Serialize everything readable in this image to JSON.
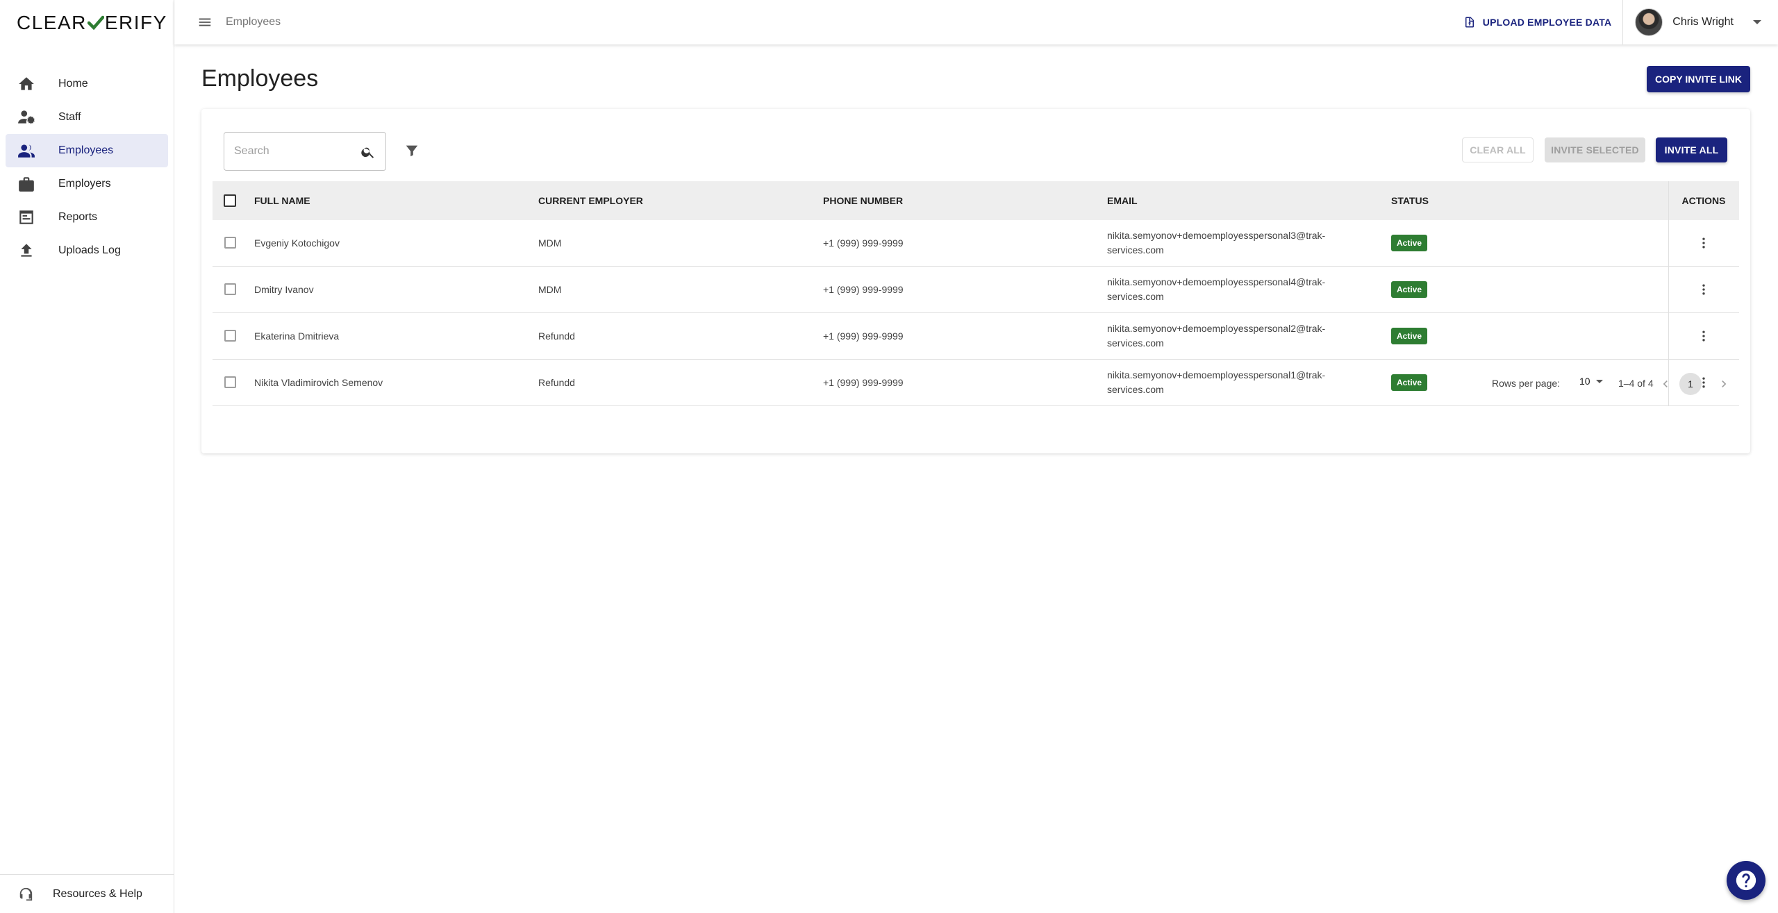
{
  "brand": {
    "logo_text_left": "CLEAR",
    "logo_text_right": "ERIFY"
  },
  "sidebar": {
    "items": [
      {
        "label": "Home",
        "icon": "home-icon",
        "active": false
      },
      {
        "label": "Staff",
        "icon": "staff-icon",
        "active": false
      },
      {
        "label": "Employees",
        "icon": "people-icon",
        "active": true
      },
      {
        "label": "Employers",
        "icon": "briefcase-icon",
        "active": false
      },
      {
        "label": "Reports",
        "icon": "reports-icon",
        "active": false
      },
      {
        "label": "Uploads Log",
        "icon": "upload-icon",
        "active": false
      }
    ],
    "footer_label": "Resources & Help"
  },
  "topbar": {
    "breadcrumb": "Employees",
    "upload_label": "UPLOAD EMPLOYEE DATA",
    "user_name": "Chris Wright"
  },
  "main": {
    "title": "Employees",
    "copy_invite_label": "COPY INVITE LINK",
    "search_placeholder": "Search",
    "clear_all_label": "CLEAR ALL",
    "invite_selected_label": "INVITE SELECTED",
    "invite_all_label": "INVITE ALL"
  },
  "table": {
    "headers": {
      "full_name": "FULL NAME",
      "current_employer": "CURRENT EMPLOYER",
      "phone": "PHONE NUMBER",
      "email": "EMAIL",
      "status": "STATUS",
      "actions": "ACTIONS"
    },
    "rows": [
      {
        "name": "Evgeniy Kotochigov",
        "employer": "MDM",
        "phone": "+1 (999) 999-9999",
        "email_line1": "nikita.semyonov+demoemployesspersonal3@trak-",
        "email_line2": "services.com",
        "status": "Active"
      },
      {
        "name": "Dmitry Ivanov",
        "employer": "MDM",
        "phone": "+1 (999) 999-9999",
        "email_line1": "nikita.semyonov+demoemployesspersonal4@trak-",
        "email_line2": "services.com",
        "status": "Active"
      },
      {
        "name": "Ekaterina Dmitrieva",
        "employer": "Refundd",
        "phone": "+1 (999) 999-9999",
        "email_line1": "nikita.semyonov+demoemployesspersonal2@trak-",
        "email_line2": "services.com",
        "status": "Active"
      },
      {
        "name": "Nikita Vladimirovich Semenov",
        "employer": "Refundd",
        "phone": "+1 (999) 999-9999",
        "email_line1": "nikita.semyonov+demoemployesspersonal1@trak-",
        "email_line2": "services.com",
        "status": "Active"
      }
    ]
  },
  "pagination": {
    "rows_per_page_label": "Rows per page:",
    "rows_per_page": "10",
    "range": "1–4 of 4",
    "current_page": "1"
  },
  "colors": {
    "primary": "#1a237e",
    "status_active": "#2e7d32",
    "logo_check": "#2e7d32"
  }
}
